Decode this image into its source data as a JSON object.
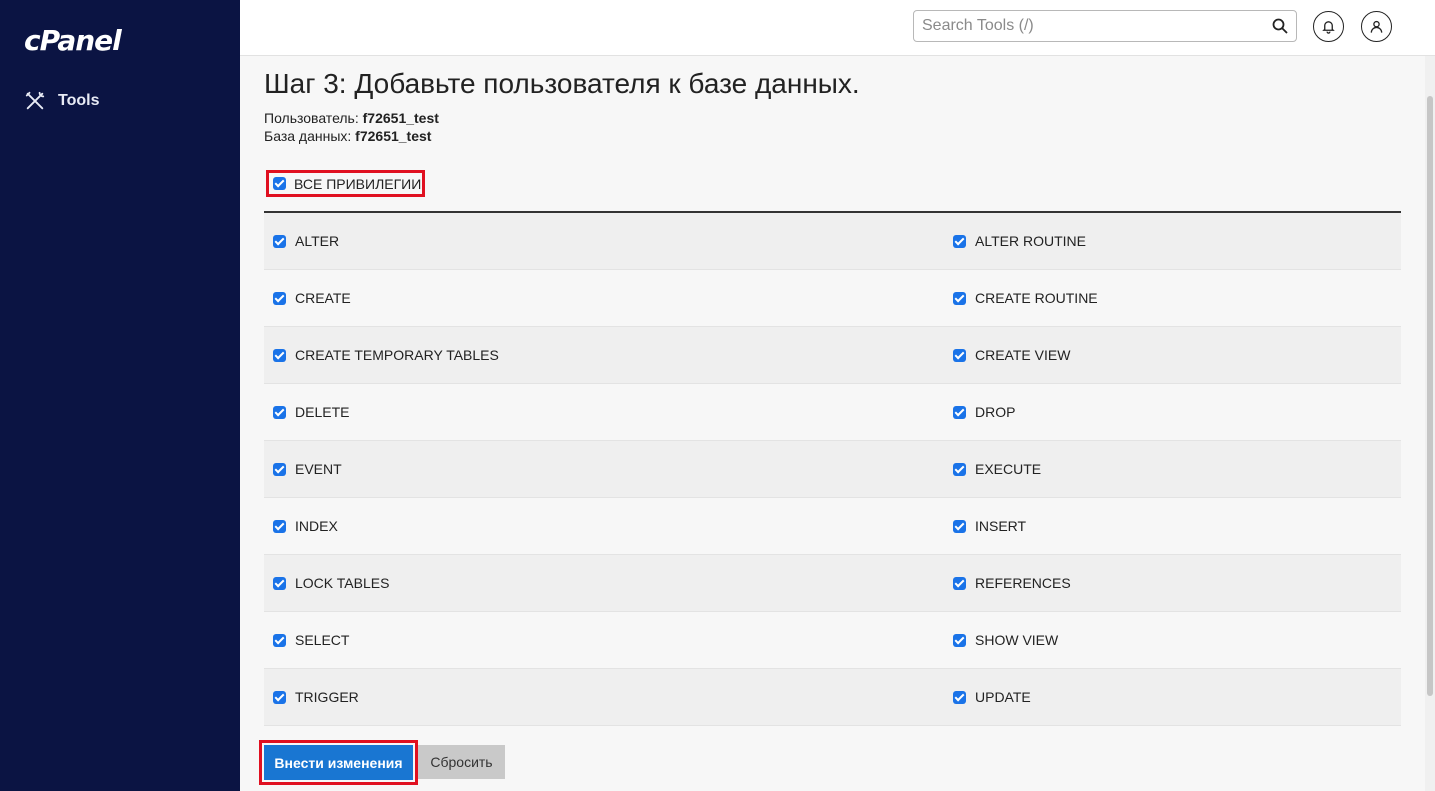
{
  "brand": {
    "logo_text": "cPanel"
  },
  "sidebar": {
    "items": [
      {
        "label": "Tools",
        "icon": "tools-icon"
      }
    ]
  },
  "topbar": {
    "search_placeholder": "Search Tools (/)",
    "search_icon": "search-icon",
    "notifications_icon": "bell-icon",
    "user_icon": "user-icon"
  },
  "page": {
    "title": "Шаг 3: Добавьте пользователя к базе данных.",
    "user_label": "Пользователь:",
    "user_value": "f72651_test",
    "db_label": "База данных:",
    "db_value": "f72651_test"
  },
  "privileges": {
    "all_label": "ВСЕ ПРИВИЛЕГИИ",
    "all_checked": true,
    "rows": [
      {
        "left": "ALTER",
        "right": "ALTER ROUTINE"
      },
      {
        "left": "CREATE",
        "right": "CREATE ROUTINE"
      },
      {
        "left": "CREATE TEMPORARY TABLES",
        "right": "CREATE VIEW"
      },
      {
        "left": "DELETE",
        "right": "DROP"
      },
      {
        "left": "EVENT",
        "right": "EXECUTE"
      },
      {
        "left": "INDEX",
        "right": "INSERT"
      },
      {
        "left": "LOCK TABLES",
        "right": "REFERENCES"
      },
      {
        "left": "SELECT",
        "right": "SHOW VIEW"
      },
      {
        "left": "TRIGGER",
        "right": "UPDATE"
      }
    ]
  },
  "actions": {
    "submit_label": "Внести изменения",
    "reset_label": "Сбросить"
  },
  "colors": {
    "sidebar_bg": "#0b1443",
    "accent": "#1976d2",
    "highlight": "#e01020"
  }
}
